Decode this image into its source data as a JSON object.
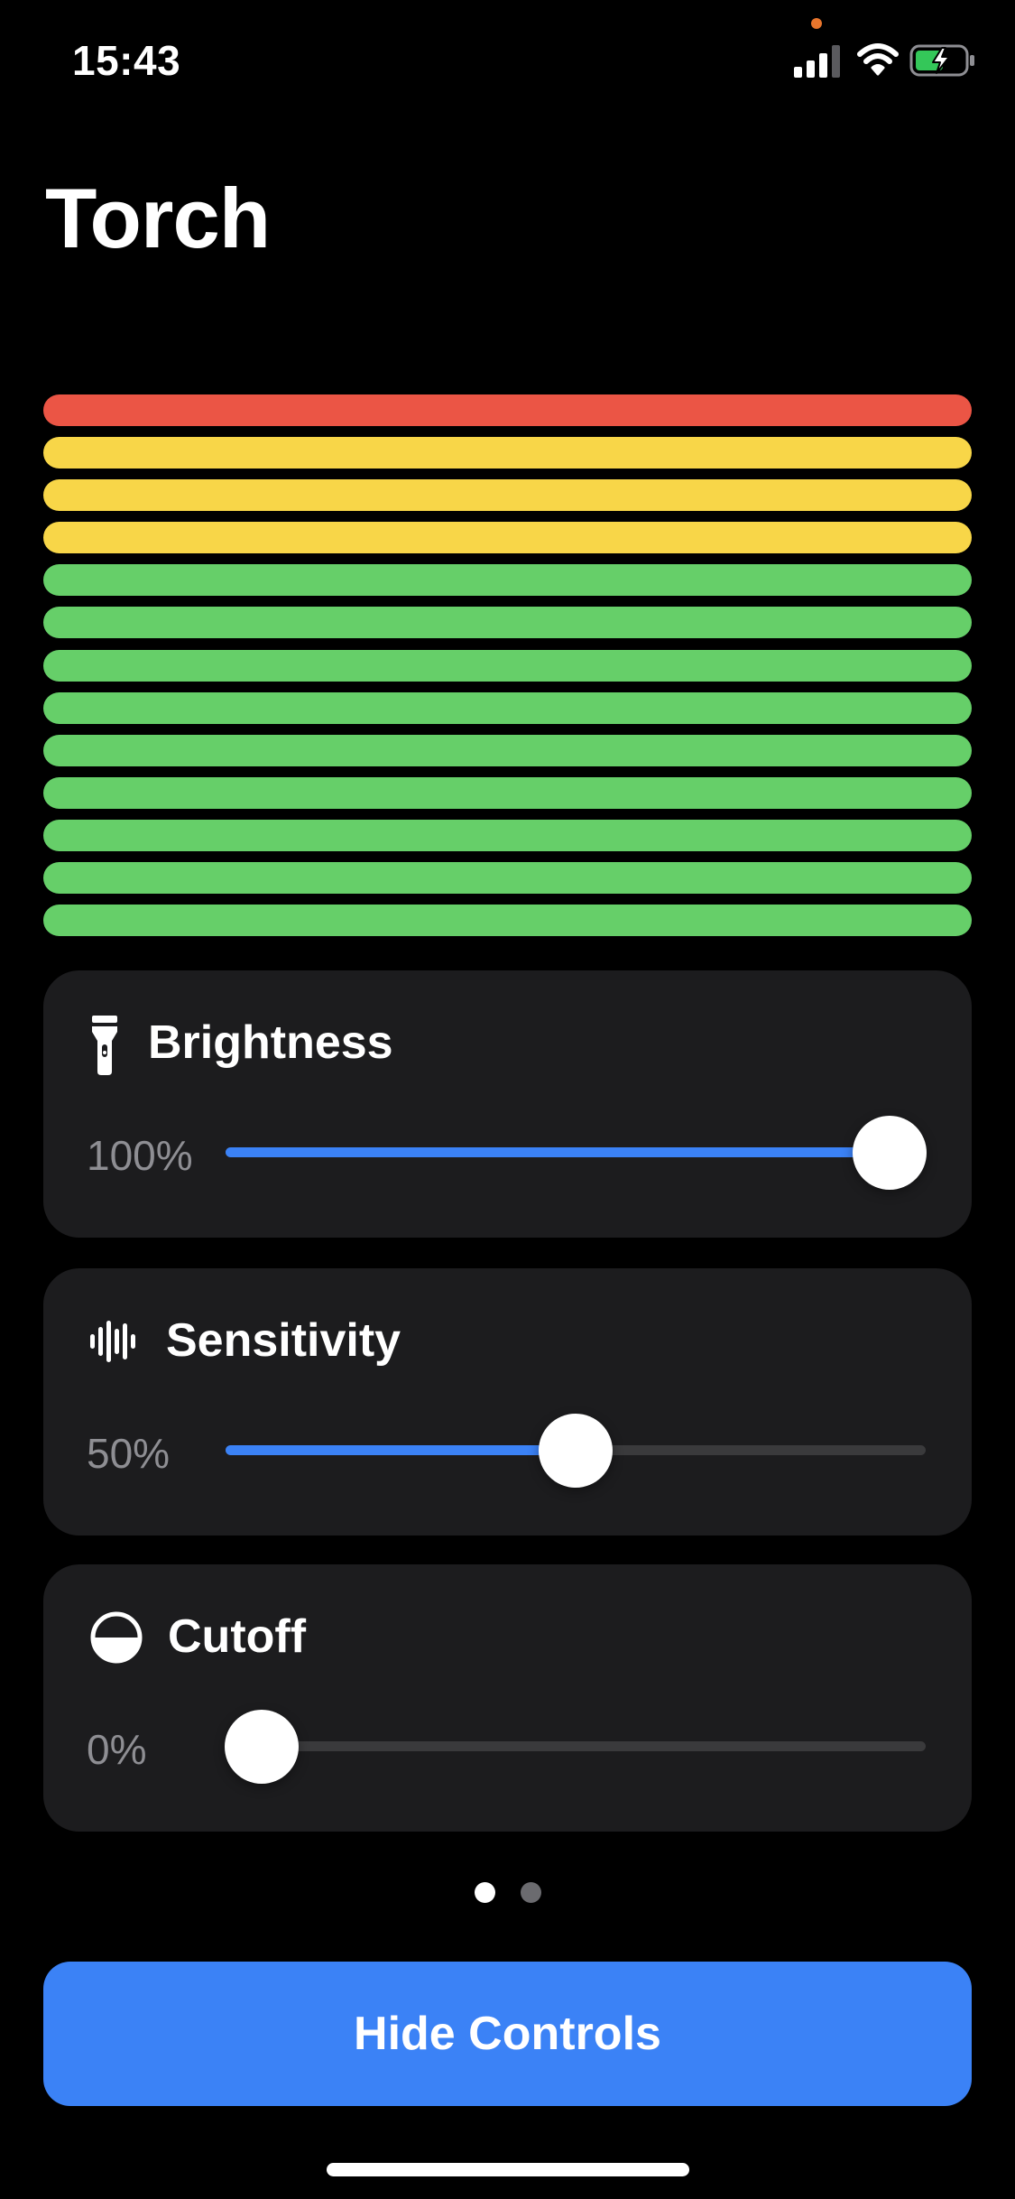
{
  "status_bar": {
    "time": "15:43",
    "icons": [
      "cellular-signal-icon",
      "wifi-icon",
      "battery-charging-icon"
    ],
    "privacy_dot_color": "#e8752c",
    "battery_color": "#34c759"
  },
  "title": "Torch",
  "level_meter": {
    "bar_count": 13,
    "bars": [
      "red",
      "yellow",
      "yellow",
      "yellow",
      "green",
      "green",
      "green",
      "green",
      "green",
      "green",
      "green",
      "green",
      "green"
    ],
    "colors": {
      "red": "#eb5545",
      "yellow": "#f8d648",
      "green": "#66cf69"
    }
  },
  "controls": [
    {
      "id": "brightness",
      "icon": "flashlight-icon",
      "label": "Brightness",
      "value_text": "100%",
      "value": 1.0
    },
    {
      "id": "sensitivity",
      "icon": "waveform-icon",
      "label": "Sensitivity",
      "value_text": "50%",
      "value": 0.5
    },
    {
      "id": "cutoff",
      "icon": "half-circle-icon",
      "label": "Cutoff",
      "value_text": "0%",
      "value": 0.0
    }
  ],
  "page_indicator": {
    "pages": 2,
    "current": 1
  },
  "hide_controls_label": "Hide Controls",
  "colors": {
    "accent": "#3b82f6",
    "card_background": "#1c1c1e",
    "secondary_text": "#8e8e93",
    "track": "#3a3a3c"
  }
}
